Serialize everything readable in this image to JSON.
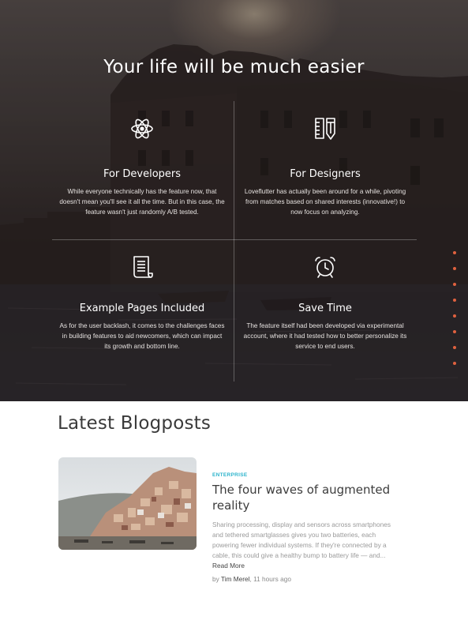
{
  "hero": {
    "title": "Your life will be much easier",
    "features": [
      {
        "icon": "atom-icon",
        "title": "For Developers",
        "description": "While everyone technically has the feature now, that doesn't mean you'll see it all the time. But in this case, the feature wasn't just randomly A/B tested."
      },
      {
        "icon": "ruler-pencil-icon",
        "title": "For Designers",
        "description": "Loveflutter has actually been around for a while, pivoting from matches based on shared interests (innovative!) to now focus on analyzing."
      },
      {
        "icon": "document-icon",
        "title": "Example Pages Included",
        "description": "As for the user backlash, it comes to the challenges faces in building features to aid newcomers, which can impact its growth and bottom line."
      },
      {
        "icon": "alarm-clock-icon",
        "title": "Save Time",
        "description": "The feature itself had been developed via experimental account, where it had tested how to better personalize its service to end users."
      }
    ],
    "dot_count": 8,
    "accent_color": "#e0613f"
  },
  "blog": {
    "heading": "Latest Blogposts",
    "post": {
      "category": "ENTERPRISE",
      "category_color": "#2db4cc",
      "title": "The four waves of augmented reality",
      "excerpt": "Sharing processing, display and sensors across smartphones and tethered smartglasses gives you two batteries, each powering fewer individual systems. If they're connected by a cable, this could give a healthy bump to battery life — and...",
      "read_more": "Read More",
      "byline_prefix": "by",
      "author": "Tim Merel",
      "time": ", 11 hours ago"
    }
  }
}
